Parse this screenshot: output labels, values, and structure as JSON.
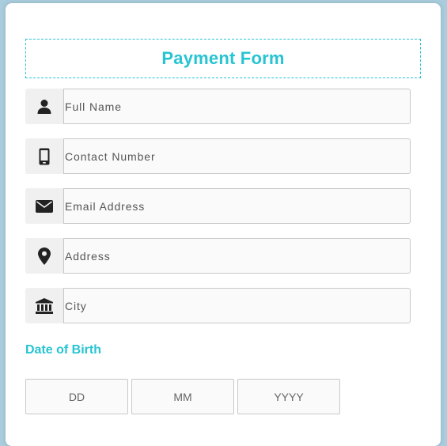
{
  "form": {
    "title": "Payment Form",
    "fields": [
      {
        "icon": "user-icon",
        "placeholder": "Full Name",
        "value": ""
      },
      {
        "icon": "mobile-phone-icon",
        "placeholder": "Contact Number",
        "value": ""
      },
      {
        "icon": "envelope-icon",
        "placeholder": "Email Address",
        "value": ""
      },
      {
        "icon": "map-marker-icon",
        "placeholder": "Address",
        "value": ""
      },
      {
        "icon": "bank-icon",
        "placeholder": "City",
        "value": ""
      }
    ],
    "dob": {
      "label": "Date of Birth",
      "day_placeholder": "DD",
      "month_placeholder": "MM",
      "year_placeholder": "YYYY"
    }
  },
  "colors": {
    "accent": "#27c4d2",
    "background": "#a9cddd",
    "icon": "#222222"
  }
}
